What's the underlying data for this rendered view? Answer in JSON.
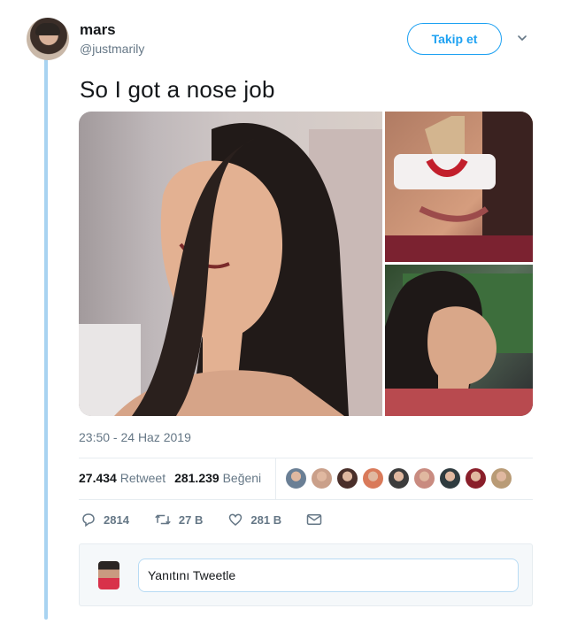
{
  "author": {
    "display_name": "mars",
    "handle": "@justmarily"
  },
  "header": {
    "follow_label": "Takip et"
  },
  "tweet": {
    "text": "So I got a nose job",
    "timestamp": "23:50 - 24 Haz 2019"
  },
  "stats": {
    "retweet_count": "27.434",
    "retweet_label": "Retweet",
    "like_count": "281.239",
    "like_label": "Beğeni"
  },
  "likers": [
    "#6a7f95",
    "#caa08a",
    "#4a2f2a",
    "#d97a5a",
    "#3c3c3c",
    "#c98b80",
    "#2f3b3f",
    "#8a1f2a",
    "#b99b76"
  ],
  "actions": {
    "reply_count": "2814",
    "retweet_count": "27 B",
    "like_count": "281 B"
  },
  "reply": {
    "placeholder": "Yanıtını Tweetle"
  },
  "colors": {
    "accent": "#1da1f2",
    "thread": "#a8d3f1",
    "muted": "#657786"
  }
}
